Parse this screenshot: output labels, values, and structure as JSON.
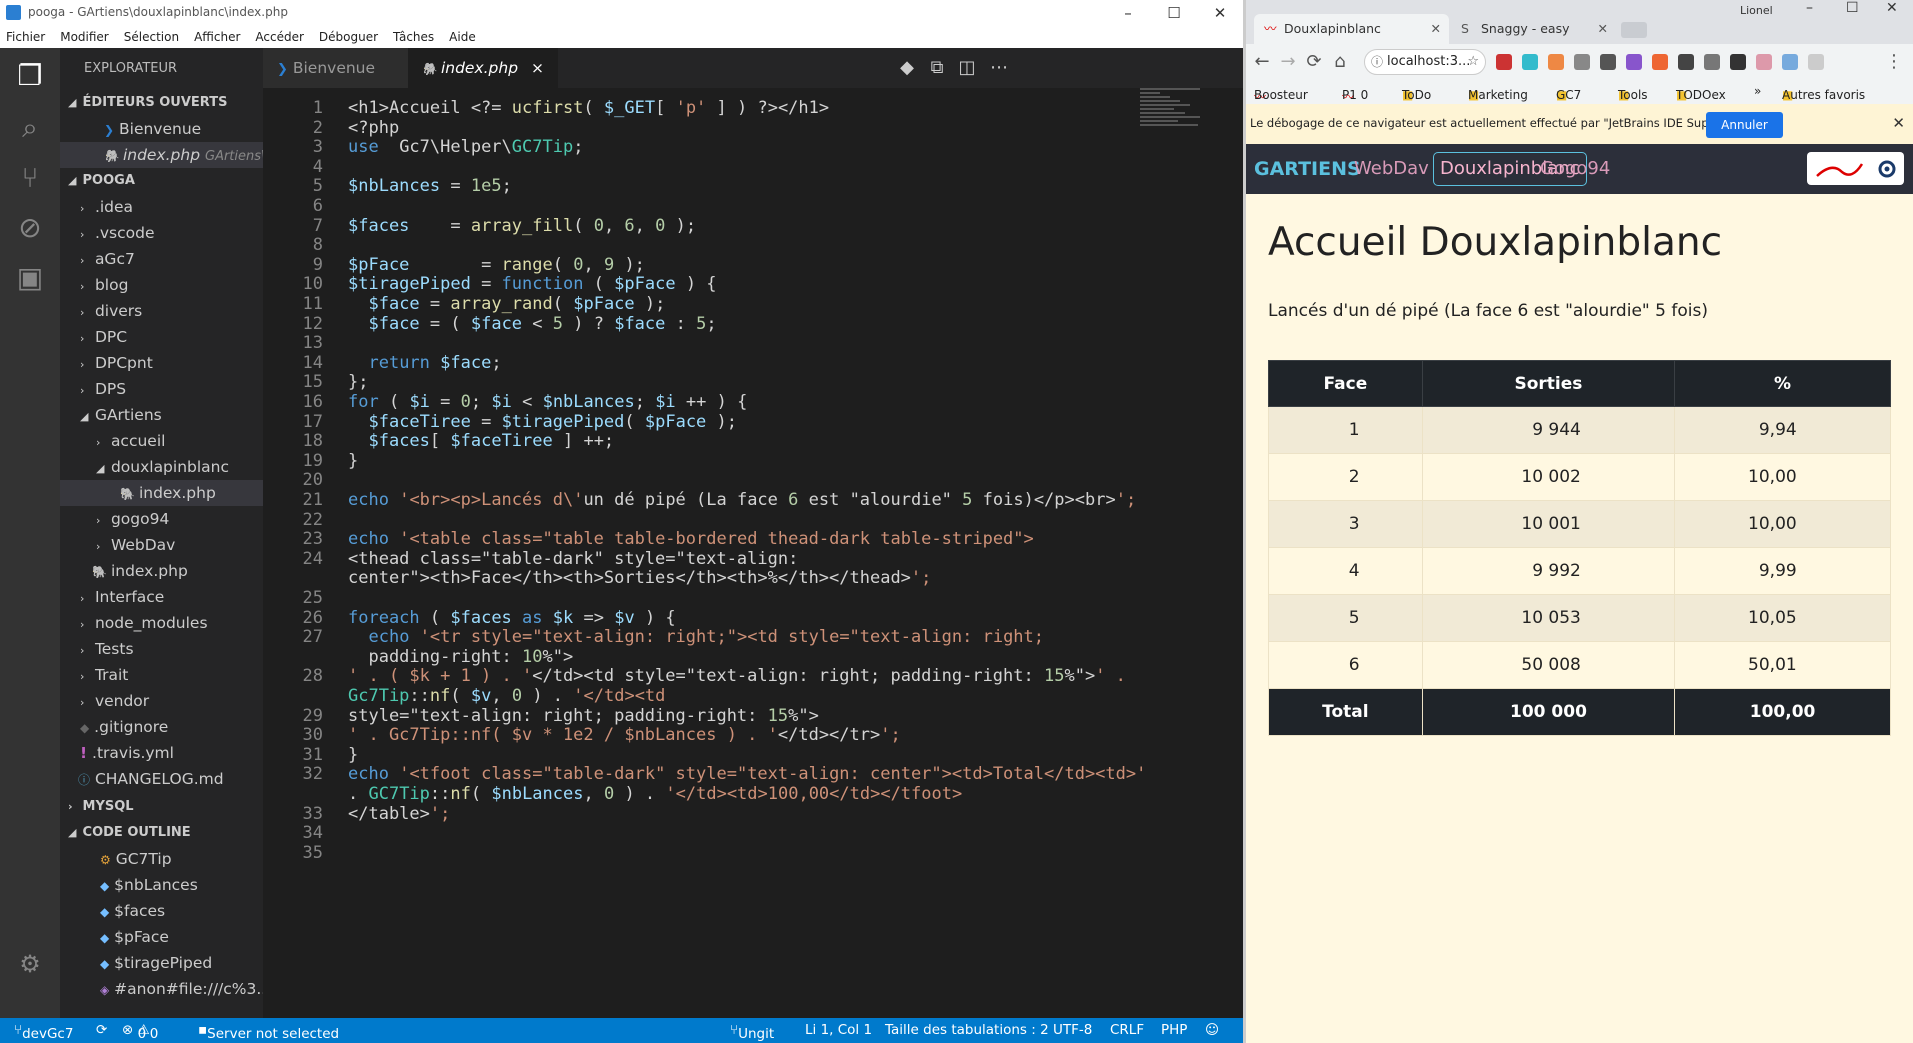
{
  "vscode": {
    "window_title": "pooga - GArtiens\\douxlapinblanc\\index.php",
    "menu": [
      "Fichier",
      "Modifier",
      "Sélection",
      "Afficher",
      "Accéder",
      "Déboguer",
      "Tâches",
      "Aide"
    ],
    "explorer_title": "EXPLORATEUR",
    "sections": {
      "open": "ÉDITEURS OUVERTS",
      "pooga": "POOGA",
      "mysql": "MYSQL",
      "outline": "CODE OUTLINE"
    },
    "open_editors": [
      {
        "label": "Bienvenue"
      },
      {
        "label": "index.php",
        "path": "GArtiens\\..."
      }
    ],
    "tree": [
      ".idea",
      ".vscode",
      "aGc7",
      "blog",
      "divers",
      "DPC",
      "DPCpnt",
      "DPS",
      "GArtiens",
      "accueil",
      "douxlapinblanc",
      "index.php",
      "gogo94",
      "WebDav",
      "index.php",
      "Interface",
      "node_modules",
      "Tests",
      "Trait",
      "vendor",
      ".gitignore",
      ".travis.yml",
      "CHANGELOG.md"
    ],
    "outline": [
      "GC7Tip",
      "$nbLances",
      "$faces",
      "$pFace",
      "$tiragePiped",
      "#anon#file:///c%3..."
    ],
    "tabs": [
      "Bienvenue",
      "index.php"
    ],
    "tab_close": "×",
    "code": [
      {
        "n": "1",
        "t": "<h1>Accueil <?= ucfirst( $_GET[ 'p' ] ) ?></h1>"
      },
      {
        "n": "2",
        "t": "<?php"
      },
      {
        "n": "3",
        "t": "use  Gc7\\Helper\\GC7Tip;"
      },
      {
        "n": "4",
        "t": ""
      },
      {
        "n": "5",
        "t": "$nbLances = 1e5;"
      },
      {
        "n": "6",
        "t": ""
      },
      {
        "n": "7",
        "t": "$faces    = array_fill( 0, 6, 0 );"
      },
      {
        "n": "8",
        "t": ""
      },
      {
        "n": "9",
        "t": "$pFace       = range( 0, 9 );"
      },
      {
        "n": "10",
        "t": "$tiragePiped = function ( $pFace ) {"
      },
      {
        "n": "11",
        "t": "  $face = array_rand( $pFace );"
      },
      {
        "n": "12",
        "t": "  $face = ( $face < 5 ) ? $face : 5;"
      },
      {
        "n": "13",
        "t": ""
      },
      {
        "n": "14",
        "t": "  return $face;"
      },
      {
        "n": "15",
        "t": "};"
      },
      {
        "n": "16",
        "t": "for ( $i = 0; $i < $nbLances; $i ++ ) {"
      },
      {
        "n": "17",
        "t": "  $faceTiree = $tiragePiped( $pFace );"
      },
      {
        "n": "18",
        "t": "  $faces[ $faceTiree ] ++;"
      },
      {
        "n": "19",
        "t": "}"
      },
      {
        "n": "20",
        "t": ""
      },
      {
        "n": "21",
        "t": "echo '<br><p>Lancés d\\'un dé pipé (La face 6 est \"alourdie\" 5 fois)</p><br>';"
      },
      {
        "n": "22",
        "t": ""
      },
      {
        "n": "23",
        "t": "echo '<table class=\"table table-bordered thead-dark table-striped\">"
      },
      {
        "n": "24",
        "t": "<thead class=\"table-dark\" style=\"text-align:"
      },
      {
        "n": "",
        "t": "center\"><th>Face</th><th>Sorties</th><th>%</th></thead>';"
      },
      {
        "n": "25",
        "t": ""
      },
      {
        "n": "26",
        "t": "foreach ( $faces as $k => $v ) {"
      },
      {
        "n": "27",
        "t": "  echo '<tr style=\"text-align: right;\"><td style=\"text-align: right;"
      },
      {
        "n": "",
        "t": "  padding-right: 10%\">"
      },
      {
        "n": "28",
        "t": "' . ( $k + 1 ) . '</td><td style=\"text-align: right; padding-right: 15%\">' ."
      },
      {
        "n": "",
        "t": "Gc7Tip::nf( $v, 0 ) . '</td><td"
      },
      {
        "n": "29",
        "t": "style=\"text-align: right; padding-right: 15%\">"
      },
      {
        "n": "30",
        "t": "' . Gc7Tip::nf( $v * 1e2 / $nbLances ) . '</td></tr>';"
      },
      {
        "n": "31",
        "t": "}"
      },
      {
        "n": "32",
        "t": "echo '<tfoot class=\"table-dark\" style=\"text-align: center\"><td>Total</td><td>'"
      },
      {
        "n": "",
        "t": ". GC7Tip::nf( $nbLances, 0 ) . '</td><td>100,00</td></tfoot>"
      },
      {
        "n": "33",
        "t": "</table>';"
      },
      {
        "n": "34",
        "t": ""
      },
      {
        "n": "35",
        "t": ""
      }
    ],
    "status": {
      "branch": "devGc7",
      "errors": "0",
      "warnings": "0",
      "server": "Server not selected",
      "ungit": "Ungit",
      "position": "Li 1, Col 1",
      "tabsize": "Taille des tabulations : 2",
      "encoding": "UTF-8",
      "eol": "CRLF",
      "lang": "PHP"
    }
  },
  "browser": {
    "user": "Lionel",
    "tabs": [
      "Douxlapinblanc",
      "Snaggy - easy screensho"
    ],
    "url": "localhost:3...",
    "bookmarks": [
      "Boosteur",
      "P1 0",
      "ToDo",
      "Marketing",
      "GC7",
      "Tools",
      "TODOex",
      "»",
      "Autres favoris"
    ],
    "debug_msg": "Le débogage de ce navigateur est actuellement effectué par \"JetBrains IDE Support\".",
    "debug_btn": "Annuler",
    "navbar": {
      "brand": "GARTIENS",
      "links": [
        "WebDav",
        "Douxlapinblanc",
        "Gogo94"
      ]
    },
    "page_title": "Accueil Douxlapinblanc",
    "intro": "Lancés d'un dé pipé (La face 6 est \"alourdie\" 5 fois)",
    "table": {
      "headers": [
        "Face",
        "Sorties",
        "%"
      ],
      "rows": [
        [
          "1",
          "9 944",
          "9,94"
        ],
        [
          "2",
          "10 002",
          "10,00"
        ],
        [
          "3",
          "10 001",
          "10,00"
        ],
        [
          "4",
          "9 992",
          "9,99"
        ],
        [
          "5",
          "10 053",
          "10,05"
        ],
        [
          "6",
          "50 008",
          "50,01"
        ]
      ],
      "footer": [
        "Total",
        "100 000",
        "100,00"
      ]
    }
  }
}
